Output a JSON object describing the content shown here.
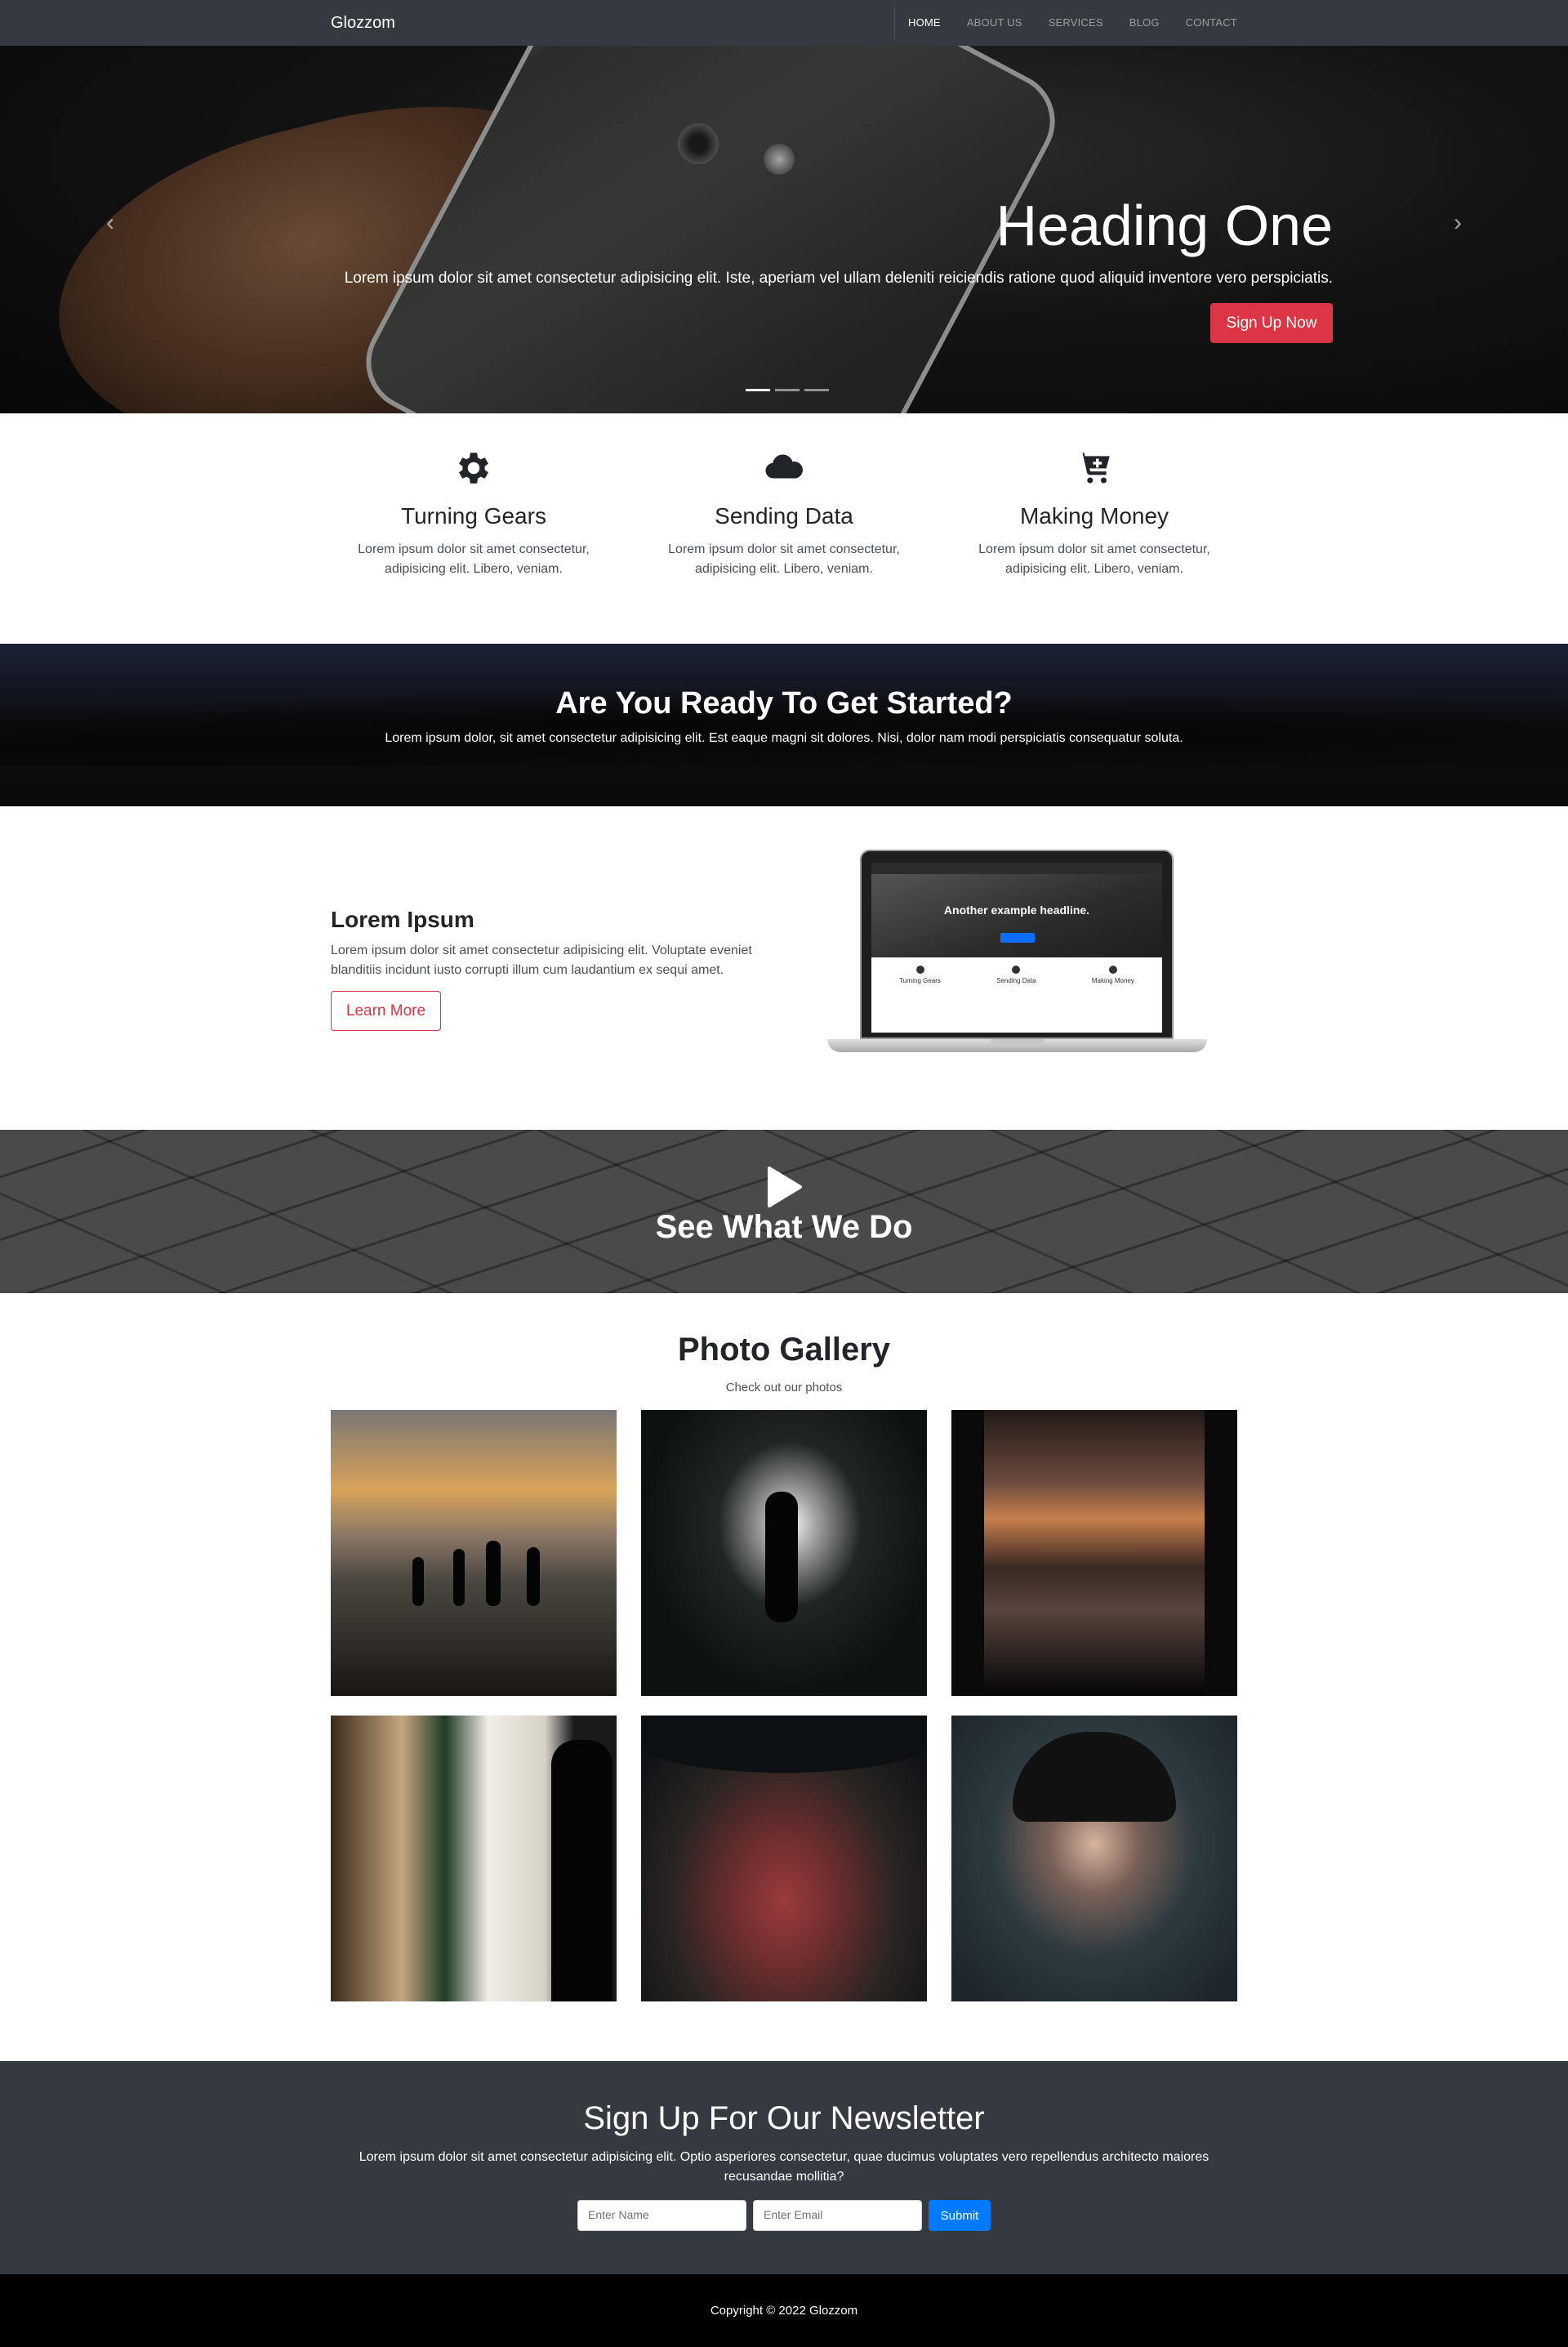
{
  "brand": "Glozzom",
  "nav": {
    "items": [
      "HOME",
      "ABOUT US",
      "SERVICES",
      "BLOG",
      "CONTACT"
    ],
    "active": "HOME"
  },
  "hero": {
    "title": "Heading One",
    "text": "Lorem ipsum dolor sit amet consectetur adipisicing elit. Iste, aperiam vel ullam deleniti reiciendis ratione quod aliquid inventore vero perspiciatis.",
    "button": "Sign Up Now",
    "prev_icon": "chevron-left-icon",
    "next_icon": "chevron-right-icon",
    "slides": 3,
    "active_slide": 1
  },
  "features": [
    {
      "icon": "gear-icon",
      "title": "Turning Gears",
      "text": "Lorem ipsum dolor sit amet consectetur, adipisicing elit. Libero, veniam."
    },
    {
      "icon": "cloud-icon",
      "title": "Sending Data",
      "text": "Lorem ipsum dolor sit amet consectetur, adipisicing elit. Libero, veniam."
    },
    {
      "icon": "cart-plus-icon",
      "title": "Making Money",
      "text": "Lorem ipsum dolor sit amet consectetur, adipisicing elit. Libero, veniam."
    }
  ],
  "ready": {
    "title": "Are You Ready To Get Started?",
    "text": "Lorem ipsum dolor, sit amet consectetur adipisicing elit. Est eaque magni sit dolores. Nisi, dolor nam modi perspiciatis consequatur soluta."
  },
  "info": {
    "title": "Lorem Ipsum",
    "text": "Lorem ipsum dolor sit amet consectetur adipisicing elit. Voluptate eveniet blanditiis incidunt iusto corrupti illum cum laudantium ex sequi amet.",
    "button": "Learn More",
    "laptop_headline": "Another example headline.",
    "laptop_features": [
      "Turning Gears",
      "Sending Data",
      "Making Money"
    ]
  },
  "video": {
    "icon": "play-icon",
    "title": "See What We Do"
  },
  "gallery": {
    "title": "Photo Gallery",
    "subtitle": "Check out our photos"
  },
  "newsletter": {
    "title": "Sign Up For Our Newsletter",
    "text": "Lorem ipsum dolor sit amet consectetur adipisicing elit. Optio asperiores consectetur, quae ducimus voluptates vero repellendus architecto maiores recusandae mollitia?",
    "name_placeholder": "Enter Name",
    "email_placeholder": "Enter Email",
    "button": "Submit"
  },
  "footer": {
    "copyright": "Copyright © 2022 Glozzom"
  },
  "colors": {
    "navbar": "#343a40",
    "danger": "#dc3545",
    "primary": "#007bff",
    "footer": "#000000"
  }
}
